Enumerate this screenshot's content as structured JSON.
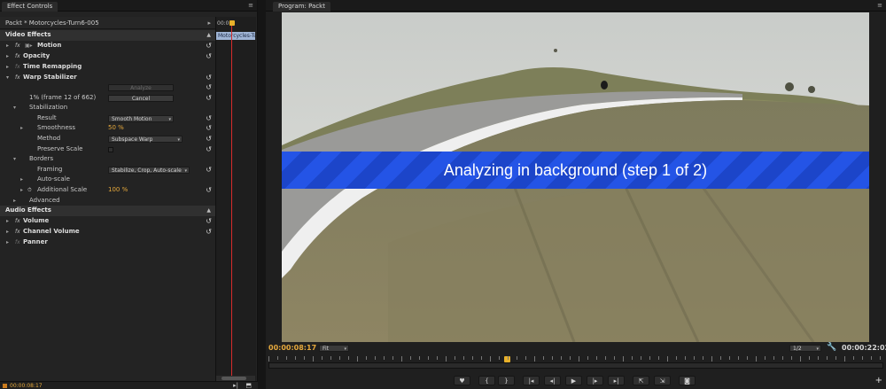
{
  "effect_controls": {
    "tab_label": "Effect Controls",
    "menu_icon": "≡",
    "clip_name": "Packt * Motorcycles-Turn6-005",
    "timeline_time": "00:00",
    "timeline_clip": "Motorcycles-Tu",
    "video_effects_label": "Video Effects",
    "audio_effects_label": "Audio Effects",
    "motion_label": "Motion",
    "opacity_label": "Opacity",
    "time_remapping_label": "Time Remapping",
    "warp_label": "Warp Stabilizer",
    "analyze_button": "Analyze",
    "progress_text": "1% (frame 12 of 662)",
    "cancel_button": "Cancel",
    "stabilization_label": "Stabilization",
    "result_label": "Result",
    "result_value": "Smooth Motion",
    "smoothness_label": "Smoothness",
    "smoothness_value": "50 %",
    "method_label": "Method",
    "method_value": "Subspace Warp",
    "preserve_scale_label": "Preserve Scale",
    "borders_label": "Borders",
    "framing_label": "Framing",
    "framing_value": "Stabilize, Crop, Auto-scale",
    "autoscale_label": "Auto-scale",
    "additional_scale_label": "Additional Scale",
    "additional_scale_value": "100 %",
    "advanced_label": "Advanced",
    "volume_label": "Volume",
    "channel_volume_label": "Channel Volume",
    "panner_label": "Panner",
    "fx_glyph": "fx",
    "reset_glyph": "↺",
    "bottom_time": "00:00:08:17"
  },
  "program_monitor": {
    "tab_label": "Program: Packt",
    "menu_icon": "≡",
    "overlay_text": "Analyzing in background (step 1 of 2)",
    "current_time": "00:00:08:17",
    "fit_value": "Fit",
    "resolution_value": "1/2",
    "duration": "00:00:22:02",
    "controls": [
      "♥",
      "{",
      "}",
      "|◂",
      "◂|",
      "▶",
      "|▸",
      "▸|",
      "⇱",
      "⇲",
      "◙"
    ],
    "add_glyph": "+"
  },
  "colors": {
    "accent_timecode": "#e5a83c",
    "playhead": "#d62c2c",
    "overlay_blue": "#2454e6"
  },
  "icons": {
    "twirl_open": "▾",
    "twirl_closed": "▸",
    "settings": "wrench-icon",
    "play": "play-icon"
  }
}
